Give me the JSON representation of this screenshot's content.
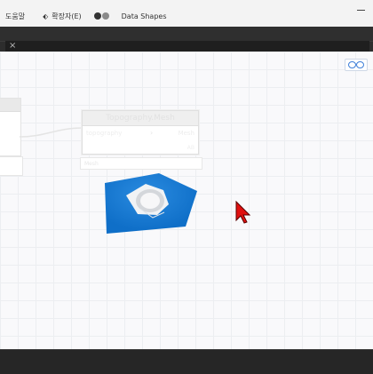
{
  "menu": {
    "help_label": "도움말",
    "extensions_label": "확장자(E)",
    "data_shapes_label": "Data Shapes"
  },
  "tab": {
    "close_glyph": "×"
  },
  "canvas": {
    "node_title": "Topography.Mesh",
    "node_input_label": "topography",
    "node_output_label": "Mesh",
    "node_footer": "AB",
    "watch_label": "Mesh"
  },
  "colors": {
    "accent": "#1e7fd3",
    "cursor": "#e01010",
    "toggle_dark": "#333333",
    "toggle_gray": "#8a8a8a"
  }
}
